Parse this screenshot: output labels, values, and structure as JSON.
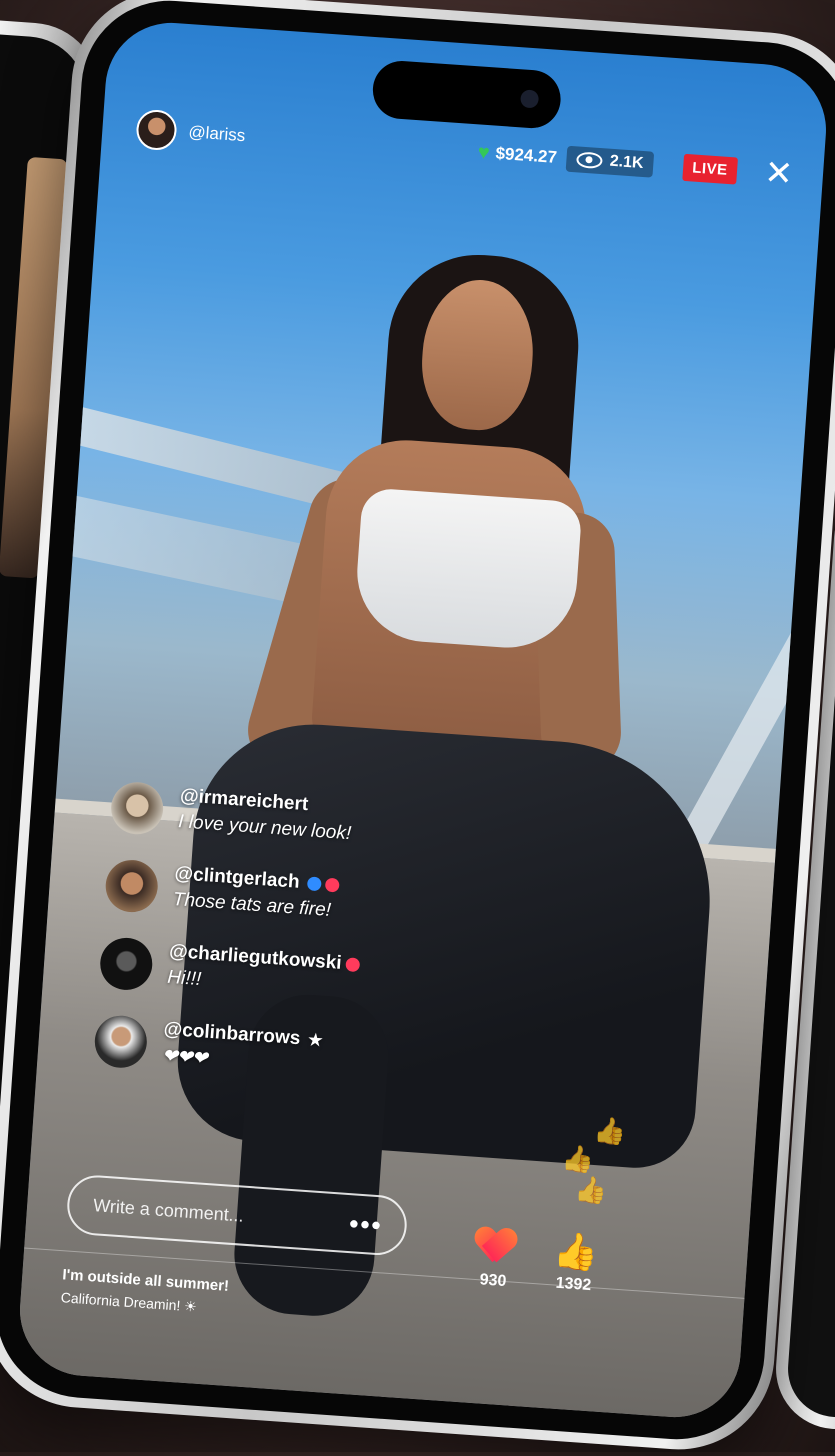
{
  "stream": {
    "host_handle": "@lariss",
    "earnings": "$924.27",
    "viewers": "2.1K",
    "live_label": "LIVE",
    "close_glyph": "✕"
  },
  "comments": [
    {
      "handle": "@irmareichert",
      "text": "I love your new look!"
    },
    {
      "handle": "@clintgerlach",
      "text": "Those tats are fire!"
    },
    {
      "handle": "@charliegutkowski",
      "text": "Hi!!!"
    },
    {
      "handle": "@colinbarrows",
      "text": "❤❤❤"
    }
  ],
  "composer": {
    "placeholder": "Write a comment...",
    "more_glyph": "•••"
  },
  "reactions": {
    "hearts": "930",
    "likes": "1392"
  },
  "caption": {
    "title": "I'm outside all summer!",
    "subtitle": "California Dreamin! ☀"
  },
  "icons": [
    "heart-icon",
    "eye-icon",
    "close-icon",
    "verified-icon",
    "star-icon",
    "thumbs-up-icon",
    "more-icon"
  ],
  "colors": {
    "live": "#e8222f",
    "earn_heart": "#34c759",
    "like": "#2e6bff",
    "heart_reaction": "#ff2a55"
  }
}
